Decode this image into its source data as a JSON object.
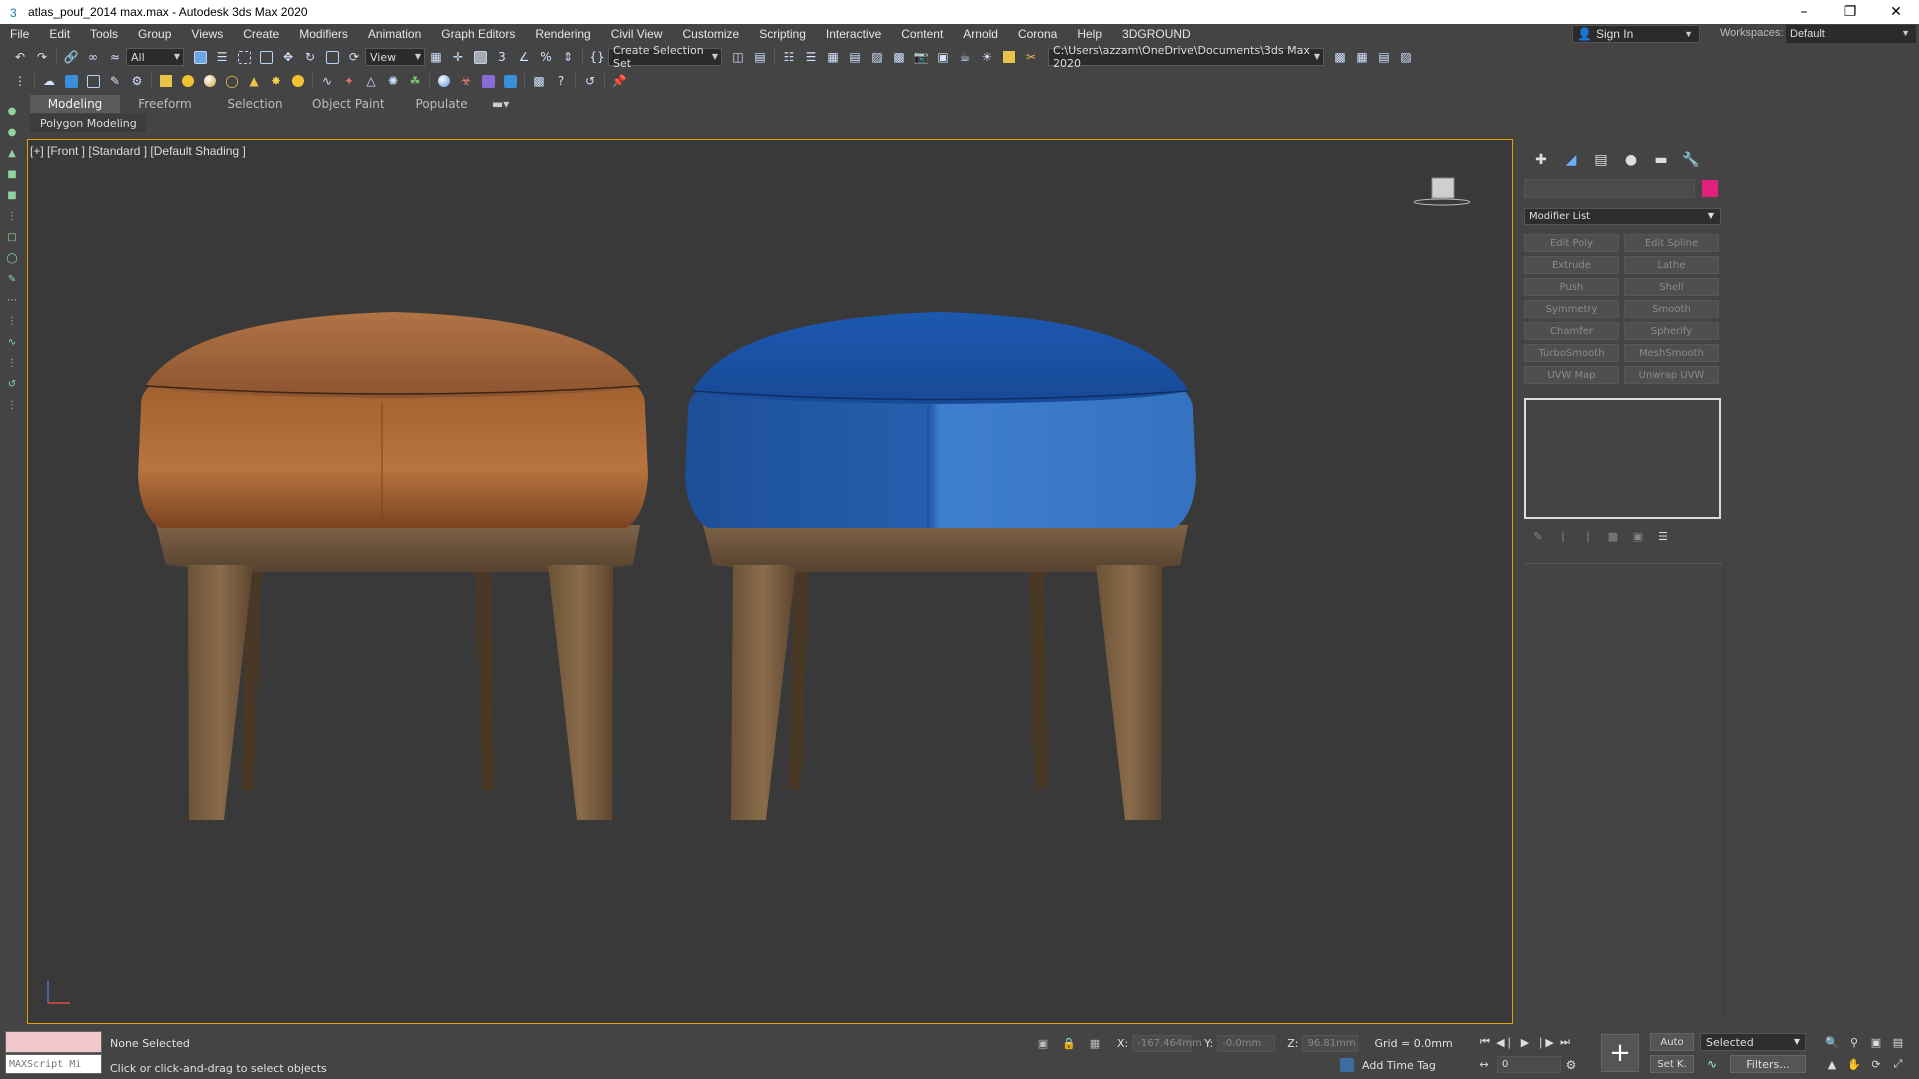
{
  "window": {
    "title": "atlas_pouf_2014 max.max - Autodesk 3ds Max 2020",
    "controls": [
      "minimize-icon",
      "restore-icon",
      "close-icon"
    ]
  },
  "menu": {
    "items": [
      "File",
      "Edit",
      "Tools",
      "Group",
      "Views",
      "Create",
      "Modifiers",
      "Animation",
      "Graph Editors",
      "Rendering",
      "Civil View",
      "Customize",
      "Scripting",
      "Interactive",
      "Content",
      "Arnold",
      "Corona",
      "Help",
      "3DGROUND"
    ],
    "sign_in": "Sign In",
    "workspaces_label": "Workspaces:",
    "workspace_value": "Default"
  },
  "toolbar1": {
    "selection_filter": "All",
    "ref_coord": "View",
    "selection_set": "Create Selection Set",
    "project_path": "C:\\Users\\azzam\\OneDrive\\Documents\\3ds Max 2020"
  },
  "ribbon": {
    "tabs": [
      "Modeling",
      "Freeform",
      "Selection",
      "Object Paint",
      "Populate"
    ],
    "active_tab": "Modeling",
    "panel_label": "Polygon Modeling"
  },
  "viewport": {
    "label": "[+] [Front ] [Standard ] [Default Shading ]",
    "objects": [
      {
        "name": "pouf-leather",
        "seat_color": "#9a5a2e",
        "seat_highlight": "#b97a45",
        "leg_color": "#6b5238"
      },
      {
        "name": "pouf-fabric",
        "seat_color": "#1f57a8",
        "seat_highlight": "#3b7acc",
        "leg_color": "#6b5238"
      }
    ],
    "border_color": "#e4a000",
    "background": "#393939"
  },
  "command_panel": {
    "tabs": [
      "create-icon",
      "modify-icon",
      "hierarchy-icon",
      "motion-icon",
      "display-icon",
      "utilities-icon"
    ],
    "color_swatch": "#e0207a",
    "modifier_list_label": "Modifier List",
    "modifier_buttons": [
      "Edit Poly",
      "Edit Spline",
      "Extrude",
      "Lathe",
      "Push",
      "Shell",
      "Symmetry",
      "Smooth",
      "Chamfer",
      "Spherify",
      "TurboSmooth",
      "MeshSmooth",
      "UVW Map",
      "Unwrap UVW"
    ]
  },
  "status": {
    "maxscript_placeholder": "MAXScript Mi",
    "selection": "None Selected",
    "prompt": "Click or click-and-drag to select objects",
    "x_label": "X:",
    "x_value": "-167.464mm",
    "y_label": "Y:",
    "y_value": "-0.0mm",
    "z_label": "Z:",
    "z_value": "96.81mm",
    "grid": "Grid = 0.0mm",
    "add_time_tag": "Add Time Tag",
    "frame": "0",
    "auto_key": "Auto",
    "set_key": "Set K.",
    "selection_set": "Selected",
    "filters": "Filters..."
  }
}
